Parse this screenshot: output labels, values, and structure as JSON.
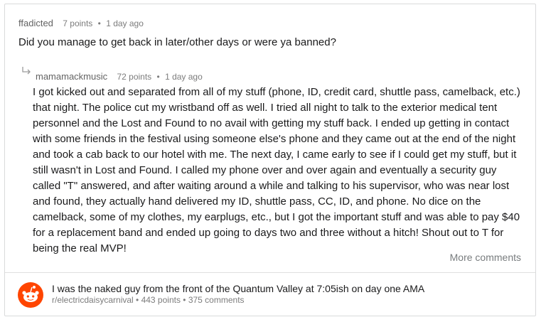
{
  "top_comment": {
    "author": "ffadicted",
    "points": "7 points",
    "separator": "•",
    "time": "1 day ago",
    "text": "Did you manage to get back in later/other days or were ya banned?"
  },
  "reply": {
    "author": "mamamackmusic",
    "points": "72 points",
    "separator": "•",
    "time": "1 day ago",
    "text": "I got kicked out and separated from all of my stuff (phone, ID, credit card, shuttle pass, camelback, etc.) that night. The police cut my wristband off as well. I tried all night to talk to the exterior medical tent personnel and the Lost and Found to no avail with getting my stuff back. I ended up getting in contact with some friends in the festival using someone else's phone and they came out at the end of the night and took a cab back to our hotel with me. The next day, I came early to see if I could get my stuff, but it still wasn't in Lost and Found. I called my phone over and over again and eventually a security guy called \"T\" answered, and after waiting around a while and talking to his supervisor, who was near lost and found, they actually hand delivered my ID, shuttle pass, CC, ID, and phone. No dice on the camelback, some of my clothes, my earplugs, etc., but I got the important stuff and was able to pay $40 for a replacement band and ended up going to days two and three without a hitch! Shout out to T for being the real MVP!"
  },
  "more_comments_label": "More comments",
  "post": {
    "icon": "reddit-snoo-icon",
    "title": "I was the naked guy from the front of the Quantum Valley at 7:05ish on day one AMA",
    "subline": "r/electricdaisycarnival • 443 points • 375 comments"
  },
  "colors": {
    "reddit_orange": "#ff4500",
    "meta_gray": "#7c7c7c",
    "text": "#1a1a1b",
    "border": "#d9dadb"
  }
}
